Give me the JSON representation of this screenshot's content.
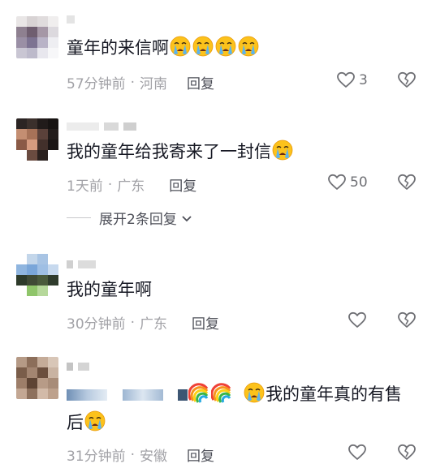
{
  "comments": [
    {
      "text": "童年的来信啊",
      "emojis": [
        "loudly-crying-face",
        "loudly-crying-face",
        "loudly-crying-face",
        "loudly-crying-face"
      ],
      "time": "57分钟前",
      "location": "河南",
      "reply_label": "回复",
      "likes": "3"
    },
    {
      "text": "我的童年给我寄来了一封信",
      "emojis": [
        "loudly-crying-face"
      ],
      "time": "1天前",
      "location": "广东",
      "reply_label": "回复",
      "likes": "50",
      "expand_label": "展开2条回复"
    },
    {
      "text": "我的童年啊",
      "time": "30分钟前",
      "location": "广东",
      "reply_label": "回复",
      "likes": ""
    },
    {
      "text_line1": "我的童年真的有售",
      "text_line2": "后",
      "emojis": [
        "rainbow",
        "rainbow",
        "loudly-crying-face",
        "loudly-crying-face"
      ],
      "time": "31分钟前",
      "location": "安徽",
      "reply_label": "回复",
      "likes": ""
    }
  ],
  "separator": "·",
  "icons": {
    "like": "heart-outline-icon",
    "dislike": "broken-heart-outline-icon",
    "expand": "chevron-down-icon"
  },
  "colors": {
    "text": "#161823",
    "meta": "#a1a1a6",
    "reply": "#4d4f58",
    "icon": "#6f7075"
  }
}
